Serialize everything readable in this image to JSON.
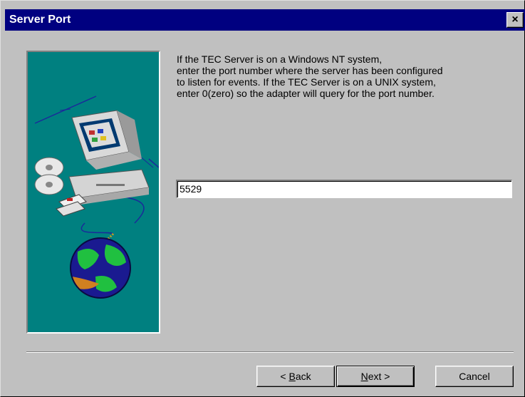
{
  "window": {
    "title": "Server Port",
    "close_glyph": "×"
  },
  "illustration": {
    "icons": [
      "computer-icon",
      "cd-icon",
      "floppy-icon",
      "globe-icon",
      "network-cable-icon"
    ]
  },
  "description": {
    "lines": [
      "If the TEC Server is on a Windows NT system,",
      "enter the port number where the server has been configured",
      "to listen for events. If the TEC Server is on a UNIX system,",
      "enter 0(zero) so the adapter will query for the port number."
    ]
  },
  "port_field": {
    "value": "5529"
  },
  "buttons": {
    "back": {
      "prefix": "< ",
      "mnemonic": "B",
      "rest": "ack"
    },
    "next": {
      "mnemonic": "N",
      "rest": "ext >"
    },
    "cancel": "Cancel"
  },
  "colors": {
    "title_bar": "#000080",
    "dialog_bg": "#c0c0c0",
    "art_bg": "#008080"
  }
}
